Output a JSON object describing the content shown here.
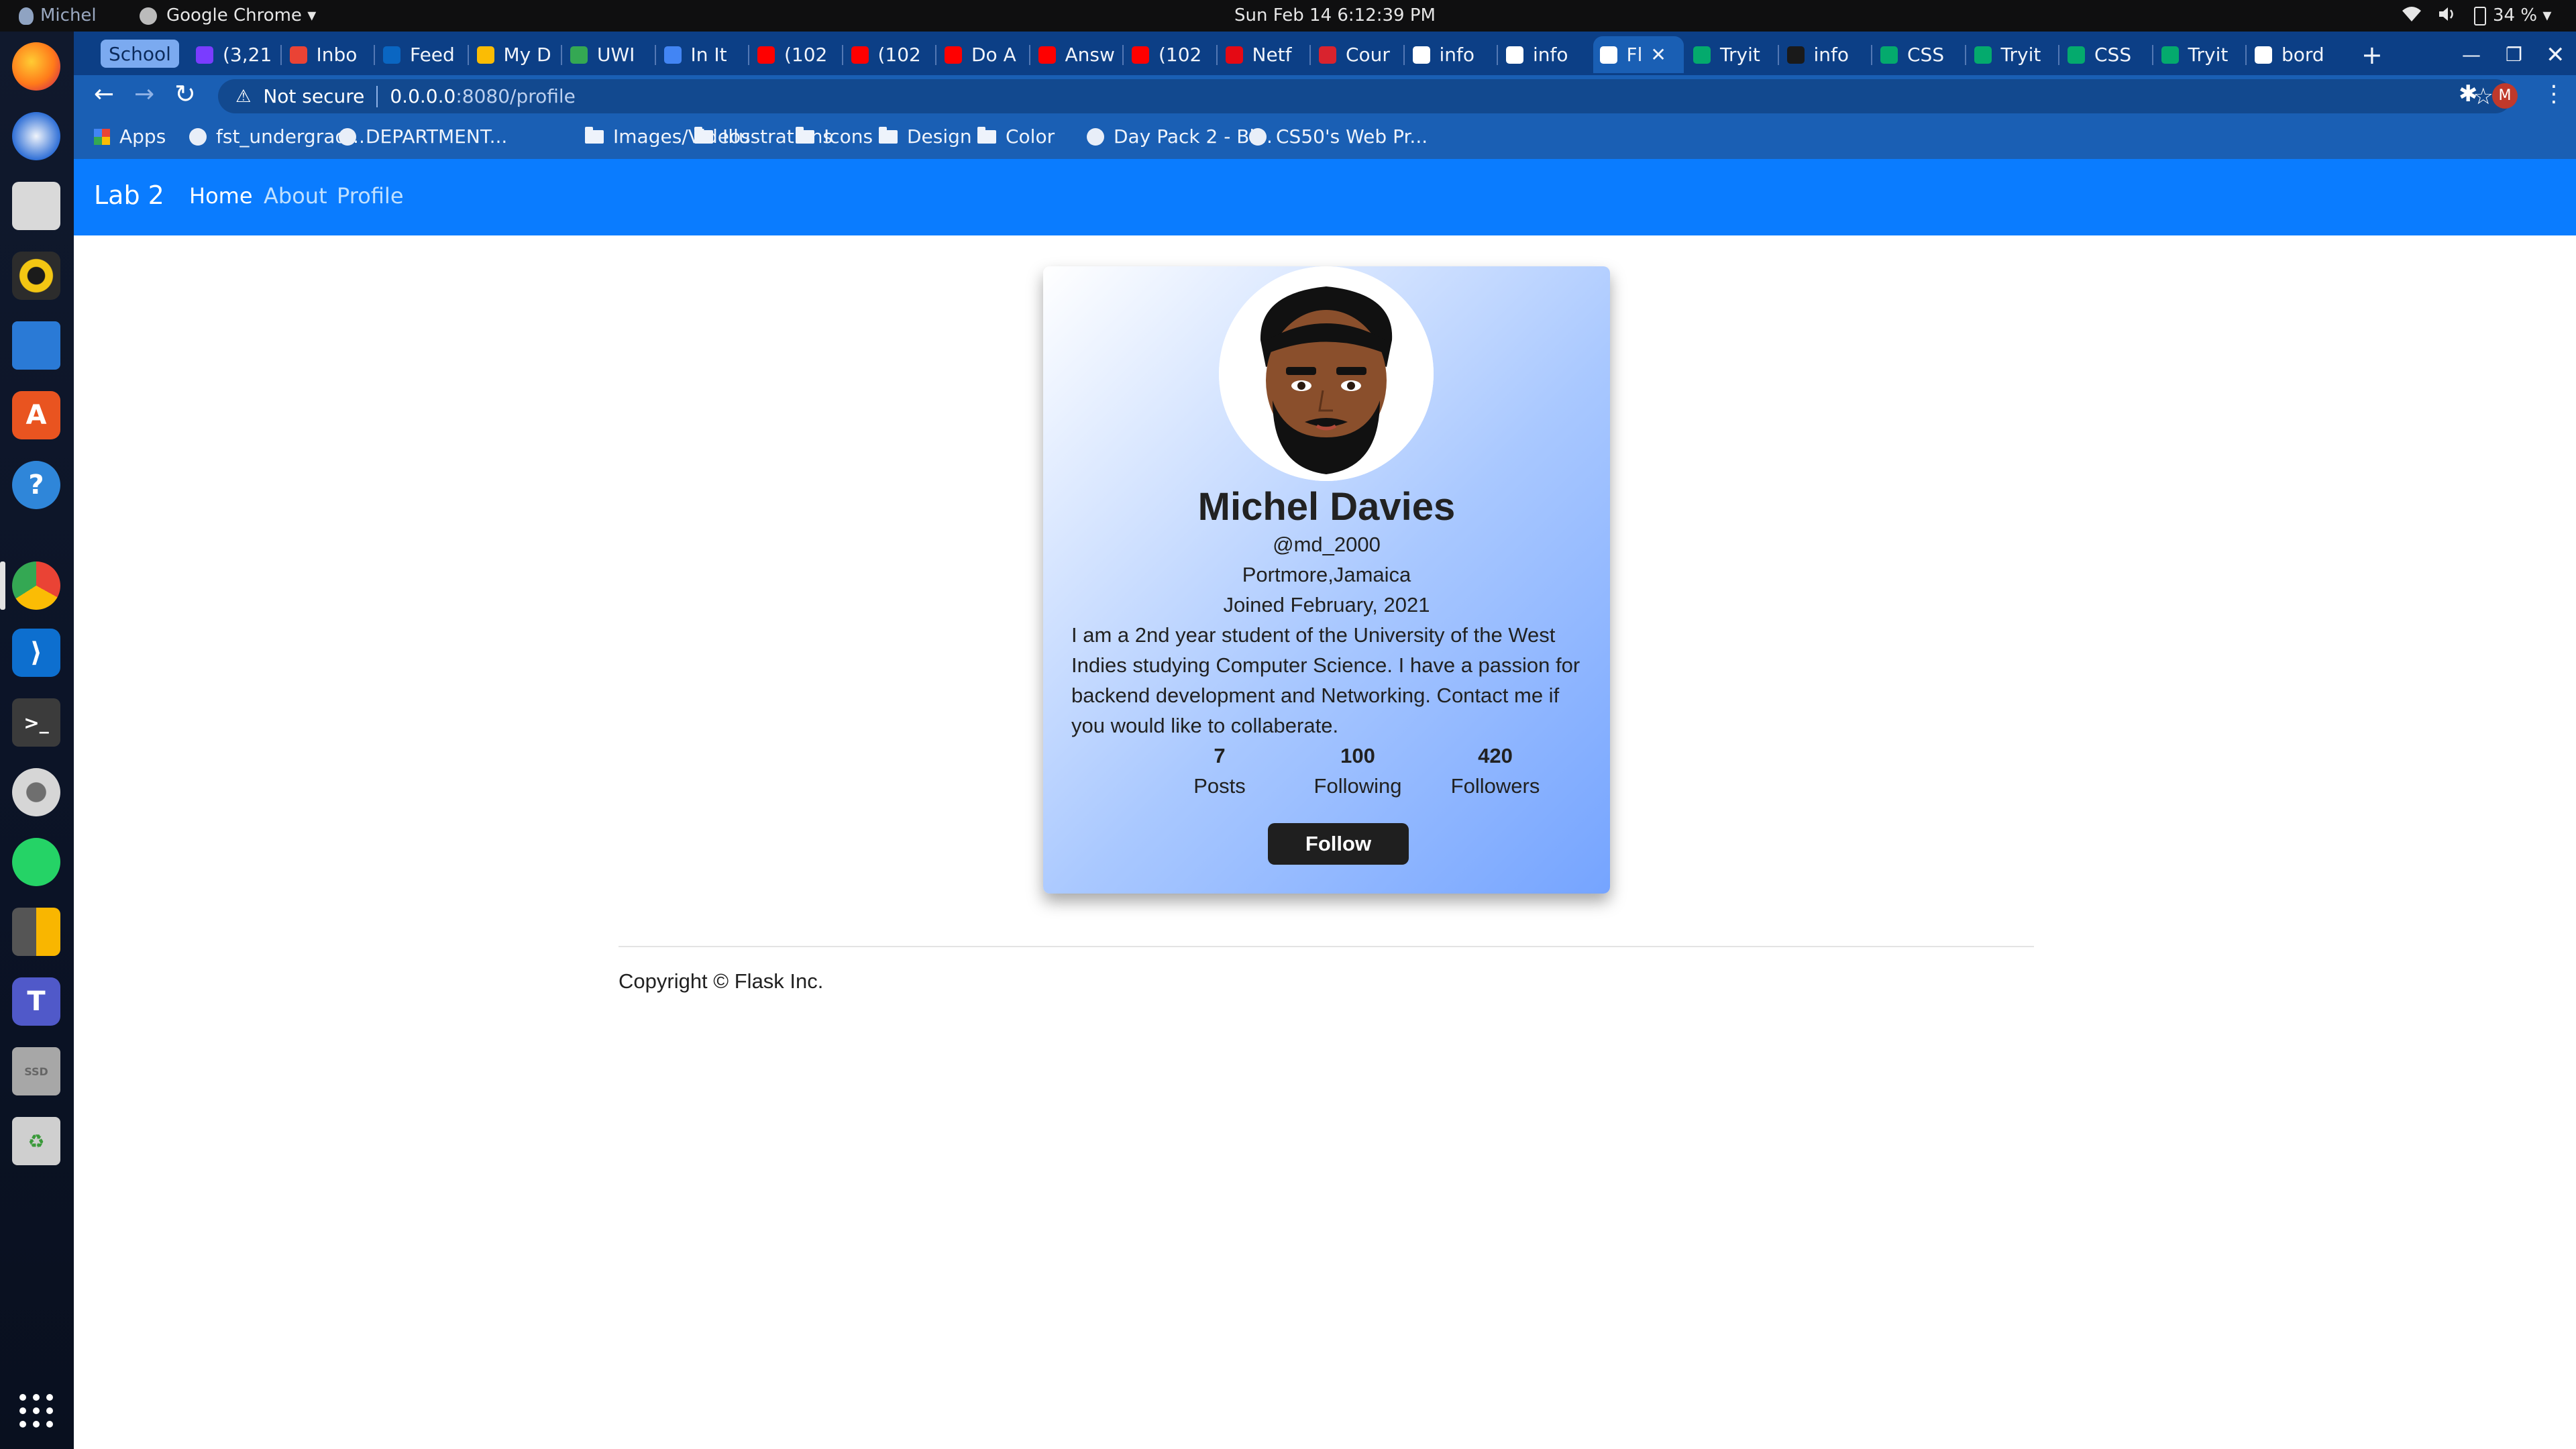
{
  "system_bar": {
    "user": "Michel",
    "app": "Google Chrome",
    "clock": "Sun Feb 14   6:12:39 PM",
    "battery": "34 %"
  },
  "browser": {
    "tab_group": "School",
    "tabs": [
      {
        "label": "(3,21",
        "color": "#7a3cff"
      },
      {
        "label": "Inbo",
        "color": "#ea4335"
      },
      {
        "label": "Feed",
        "color": "#0a66c2"
      },
      {
        "label": "My D",
        "color": "#fbbc04"
      },
      {
        "label": "UWI",
        "color": "#34a853"
      },
      {
        "label": "In It",
        "color": "#4285f4"
      },
      {
        "label": "(102",
        "color": "#ff0000"
      },
      {
        "label": "(102",
        "color": "#ff0000"
      },
      {
        "label": "Do A",
        "color": "#ff0000"
      },
      {
        "label": "Answ",
        "color": "#ff0000"
      },
      {
        "label": "(102",
        "color": "#ff0000"
      },
      {
        "label": "Netf",
        "color": "#e50914"
      },
      {
        "label": "Cour",
        "color": "#d9232e"
      },
      {
        "label": "info",
        "color": "#ffffff"
      },
      {
        "label": "info",
        "color": "#ffffff"
      },
      {
        "label": "Fl",
        "color": "#ffffff",
        "active": true
      },
      {
        "label": "Tryit",
        "color": "#04aa6d"
      },
      {
        "label": "info",
        "color": "#1a1a1a"
      },
      {
        "label": "CSS",
        "color": "#04aa6d"
      },
      {
        "label": "Tryit",
        "color": "#04aa6d"
      },
      {
        "label": "CSS",
        "color": "#04aa6d"
      },
      {
        "label": "Tryit",
        "color": "#04aa6d"
      },
      {
        "label": "bord",
        "color": "#ffffff"
      }
    ],
    "security": "Not secure",
    "url_host": "0.0.0.0",
    "url_rest": ":8080/profile",
    "profile_initial": "M",
    "bookmarks": [
      {
        "label": "Apps",
        "icon": "apps-grid-icon"
      },
      {
        "label": "fst_undergrad...",
        "icon": "site-icon"
      },
      {
        "label": "DEPARTMENT...",
        "icon": "site-icon"
      },
      {
        "label": "Images/Videos",
        "icon": "folder-icon"
      },
      {
        "label": "Illustrations",
        "icon": "folder-icon"
      },
      {
        "label": "Icons",
        "icon": "folder-icon"
      },
      {
        "label": "Design",
        "icon": "folder-icon"
      },
      {
        "label": "Color",
        "icon": "folder-icon"
      },
      {
        "label": "Day Pack 2 - Bl...",
        "icon": "site-icon"
      },
      {
        "label": "CS50's Web Pr...",
        "icon": "site-icon"
      }
    ]
  },
  "navbar": {
    "brand": "Lab 2",
    "links": [
      "Home",
      "About",
      "Profile"
    ]
  },
  "profile": {
    "name": "Michel Davies",
    "username": "@md_2000",
    "location": "Portmore,Jamaica",
    "joined": "Joined February, 2021",
    "bio": "I am a 2nd year student of the University of the West Indies studying Computer Science. I have a passion for backend development and Networking. Contact me if you would like to collaberate.",
    "stats": [
      {
        "value": "7",
        "label": "Posts"
      },
      {
        "value": "100",
        "label": "Following"
      },
      {
        "value": "420",
        "label": "Followers"
      }
    ],
    "follow_label": "Follow"
  },
  "footer": {
    "text": "Copyright © Flask Inc."
  },
  "colors": {
    "navbar": "#0a7cff",
    "chrome": "#1a5fb4",
    "follow_button": "#1f1f1f"
  }
}
